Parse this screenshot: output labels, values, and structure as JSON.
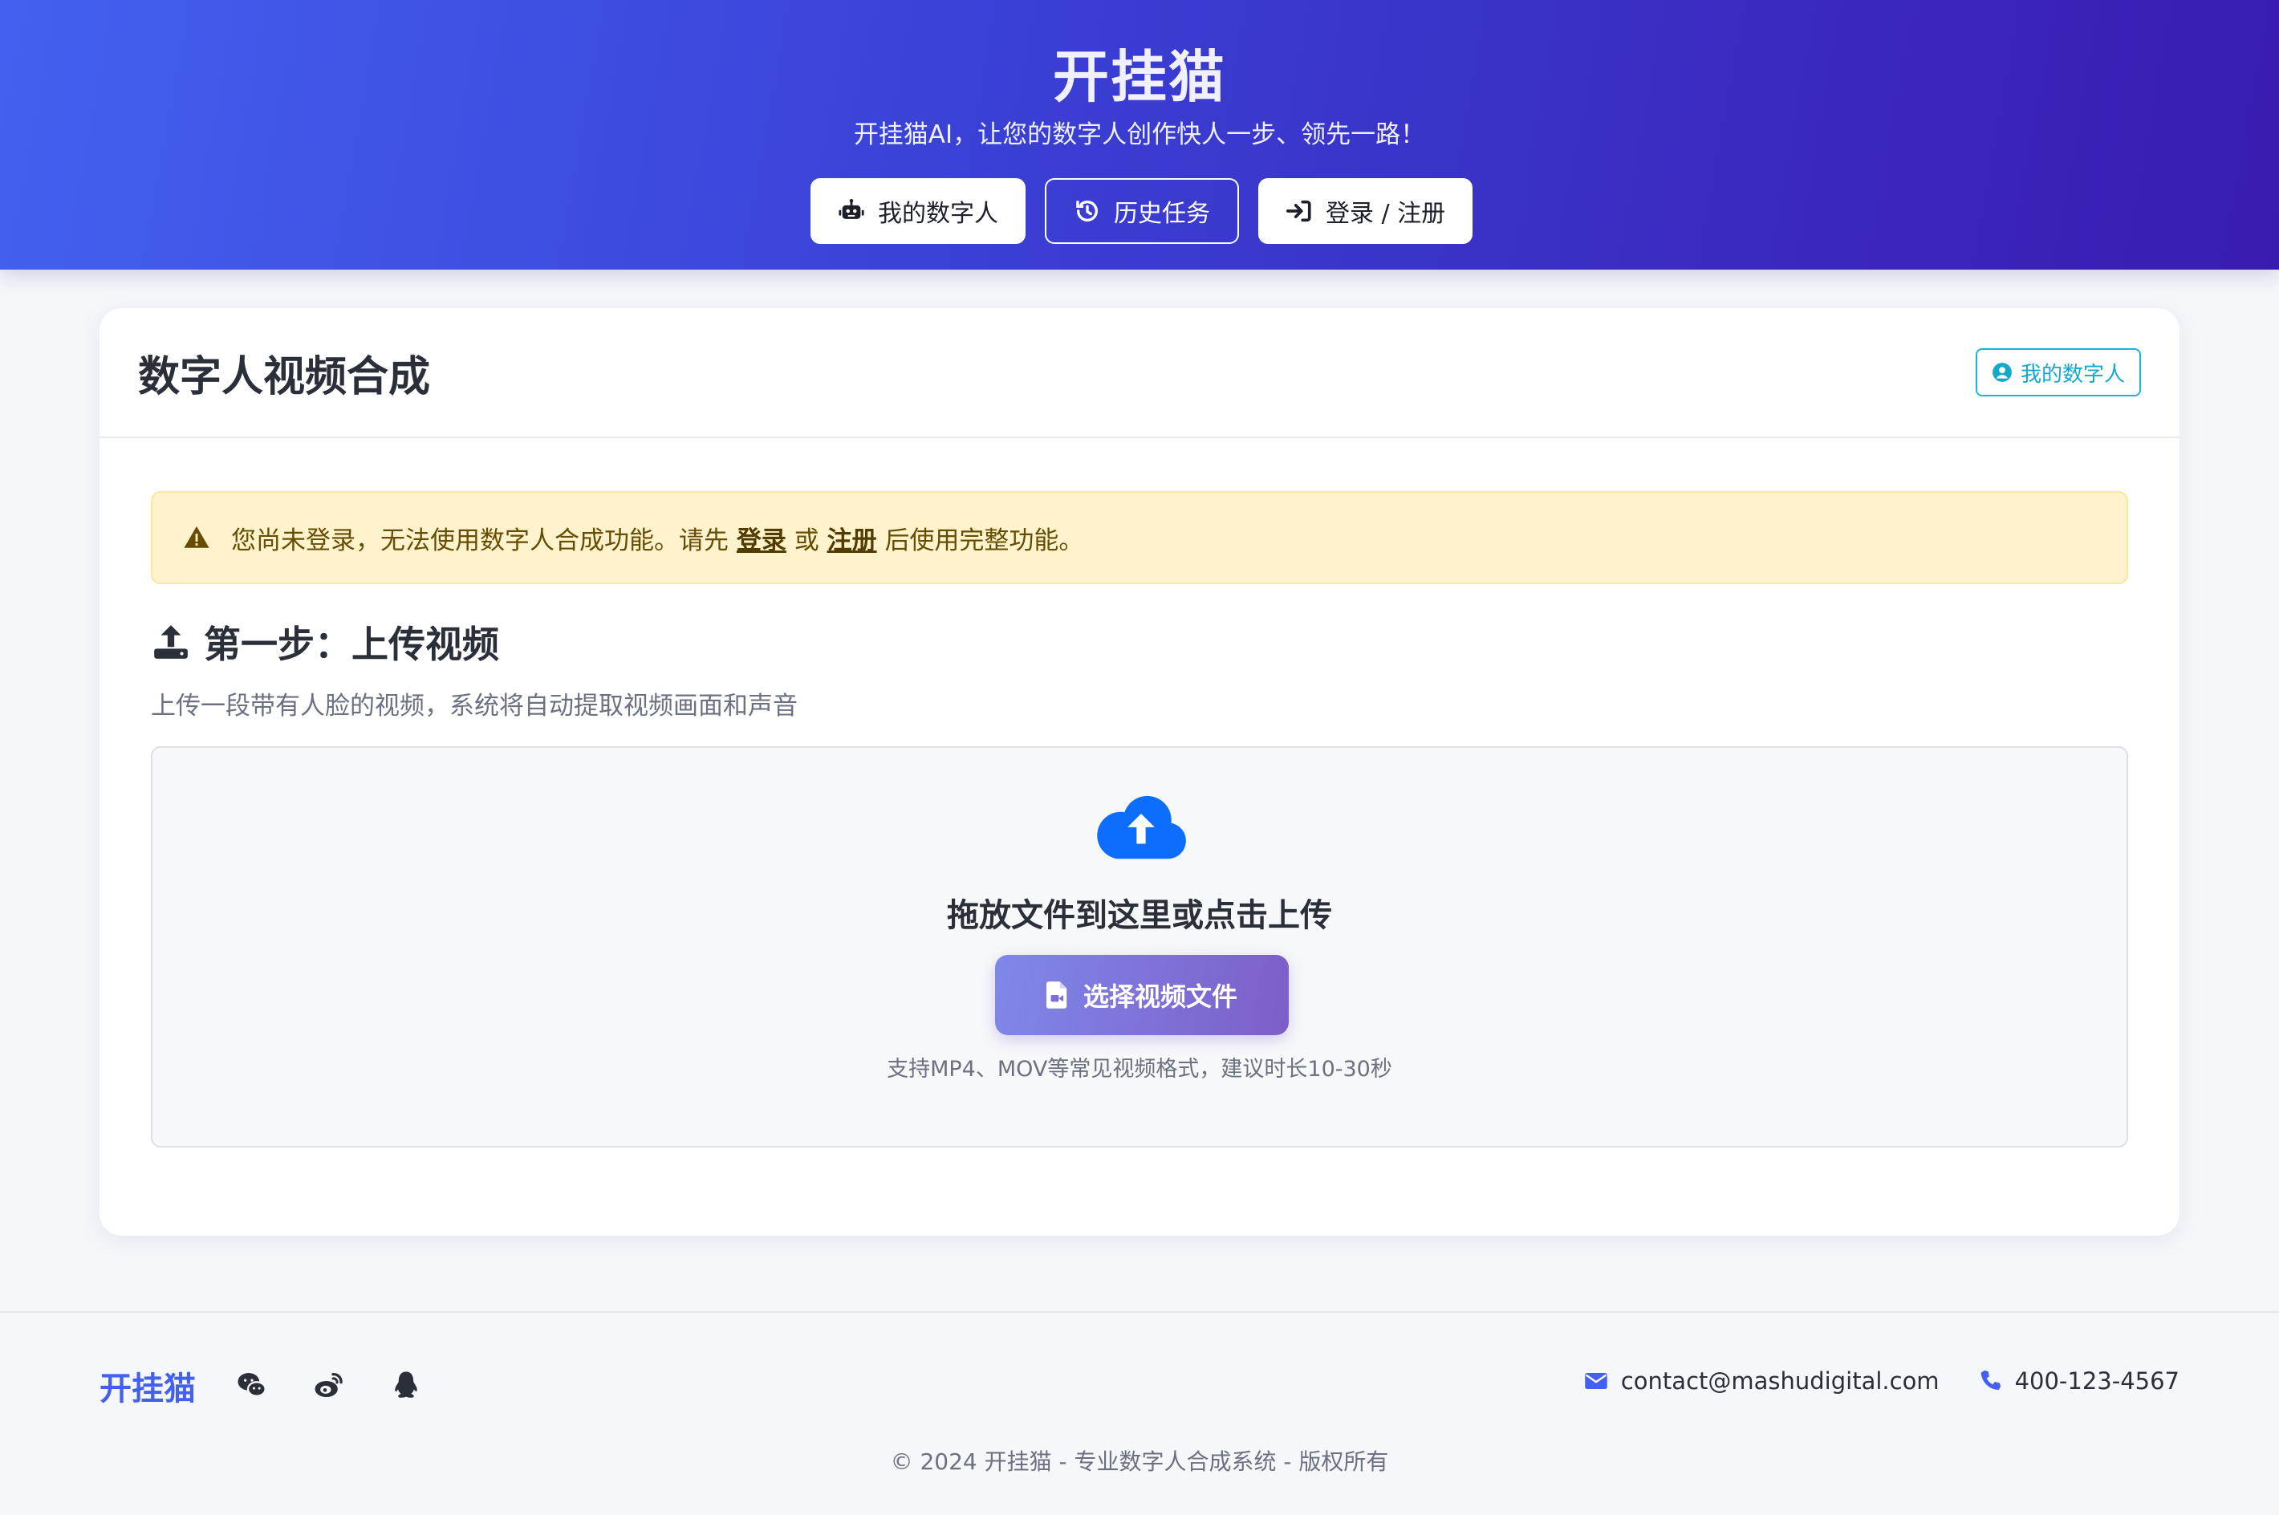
{
  "header": {
    "brand": "开挂猫",
    "tagline": "开挂猫AI，让您的数字人创作快人一步、领先一路！",
    "nav": [
      {
        "label": "我的数字人",
        "icon": "robot-icon"
      },
      {
        "label": "历史任务",
        "icon": "history-icon"
      },
      {
        "label": "登录 / 注册",
        "icon": "sign-in-icon"
      }
    ]
  },
  "card": {
    "title": "数字人视频合成",
    "my_digital_button": "我的数字人",
    "alert": {
      "prefix": "您尚未登录，无法使用数字人合成功能。请先",
      "login_link": "登录",
      "or": "或",
      "register_link": "注册",
      "suffix": "后使用完整功能。"
    },
    "step": {
      "title": "第一步：上传视频",
      "description": "上传一段带有人脸的视频，系统将自动提取视频画面和声音"
    },
    "upload": {
      "drop_text": "拖放文件到这里或点击上传",
      "choose_button": "选择视频文件",
      "hint": "支持MP4、MOV等常见视频格式，建议时长10-30秒"
    }
  },
  "footer": {
    "logo": "开挂猫",
    "social_icons": [
      "wechat-icon",
      "weibo-icon",
      "qq-icon"
    ],
    "email": "contact@mashudigital.com",
    "phone": "400-123-4567",
    "copyright": "© 2024 开挂猫 - 专业数字人合成系统 - 版权所有"
  },
  "colors": {
    "header_gradient_start": "#4361ee",
    "header_gradient_end": "#3a1bb0",
    "accent": "#4361ee",
    "info_outline": "#18b5d6",
    "alert_bg": "#fff3cd",
    "upload_icon": "#0d6efd"
  }
}
